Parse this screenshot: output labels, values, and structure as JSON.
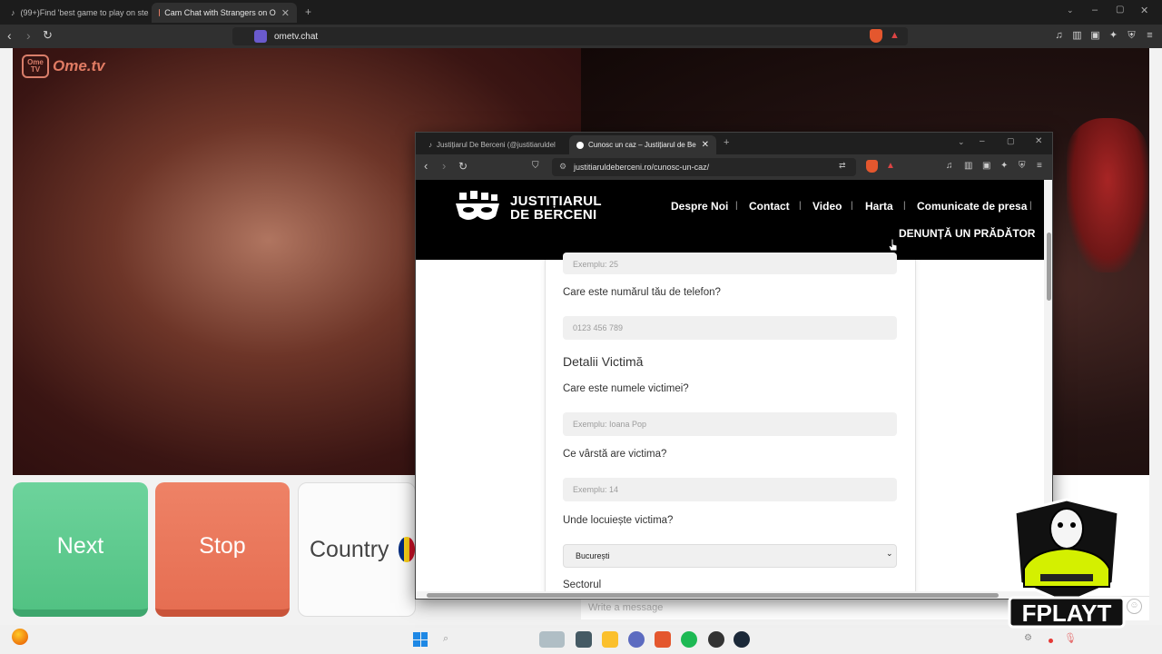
{
  "outer_browser": {
    "tabs": [
      {
        "label": "(99+)Find 'best game to play on stea",
        "active": false
      },
      {
        "label": "Cam Chat with Strangers on O",
        "active": true
      }
    ],
    "url": "ometv.chat"
  },
  "ometv": {
    "logo_badge": "Ome TV",
    "logo_text": "Ome.tv",
    "next_label": "Next",
    "stop_label": "Stop",
    "country_label": "Country",
    "message_placeholder": "Write a message"
  },
  "inner_browser": {
    "tabs": [
      {
        "label": "Justițiarul De Berceni (@justitiaruldel",
        "active": false
      },
      {
        "label": "Cunosc un caz – Justițiarul de Be",
        "active": true
      }
    ],
    "url": "justitiaruldeberceni.ro/cunosc-un-caz/"
  },
  "site": {
    "logo_line1": "JUSTIȚIARUL",
    "logo_line2": "DE BERCENI",
    "nav": [
      "Despre Noi",
      "Contact",
      "Video",
      "Harta",
      "Comunicate de presa"
    ],
    "cta": "DENUNȚĂ UN PRĂDĂTOR"
  },
  "form": {
    "partial_field_placeholder": "Exemplu: 25",
    "phone_label": "Care este numărul tău de telefon?",
    "phone_placeholder": "0123 456 789",
    "section_title": "Detalii Victimă",
    "victim_name_label": "Care este numele victimei?",
    "victim_name_placeholder": "Exemplu: Ioana Pop",
    "victim_age_label": "Ce vârstă are victima?",
    "victim_age_placeholder": "Exemplu: 14",
    "victim_location_label": "Unde locuiește victima?",
    "victim_location_value": "București",
    "sector_label": "Sectorul"
  },
  "overlay": {
    "brand": "FPLAYT"
  }
}
